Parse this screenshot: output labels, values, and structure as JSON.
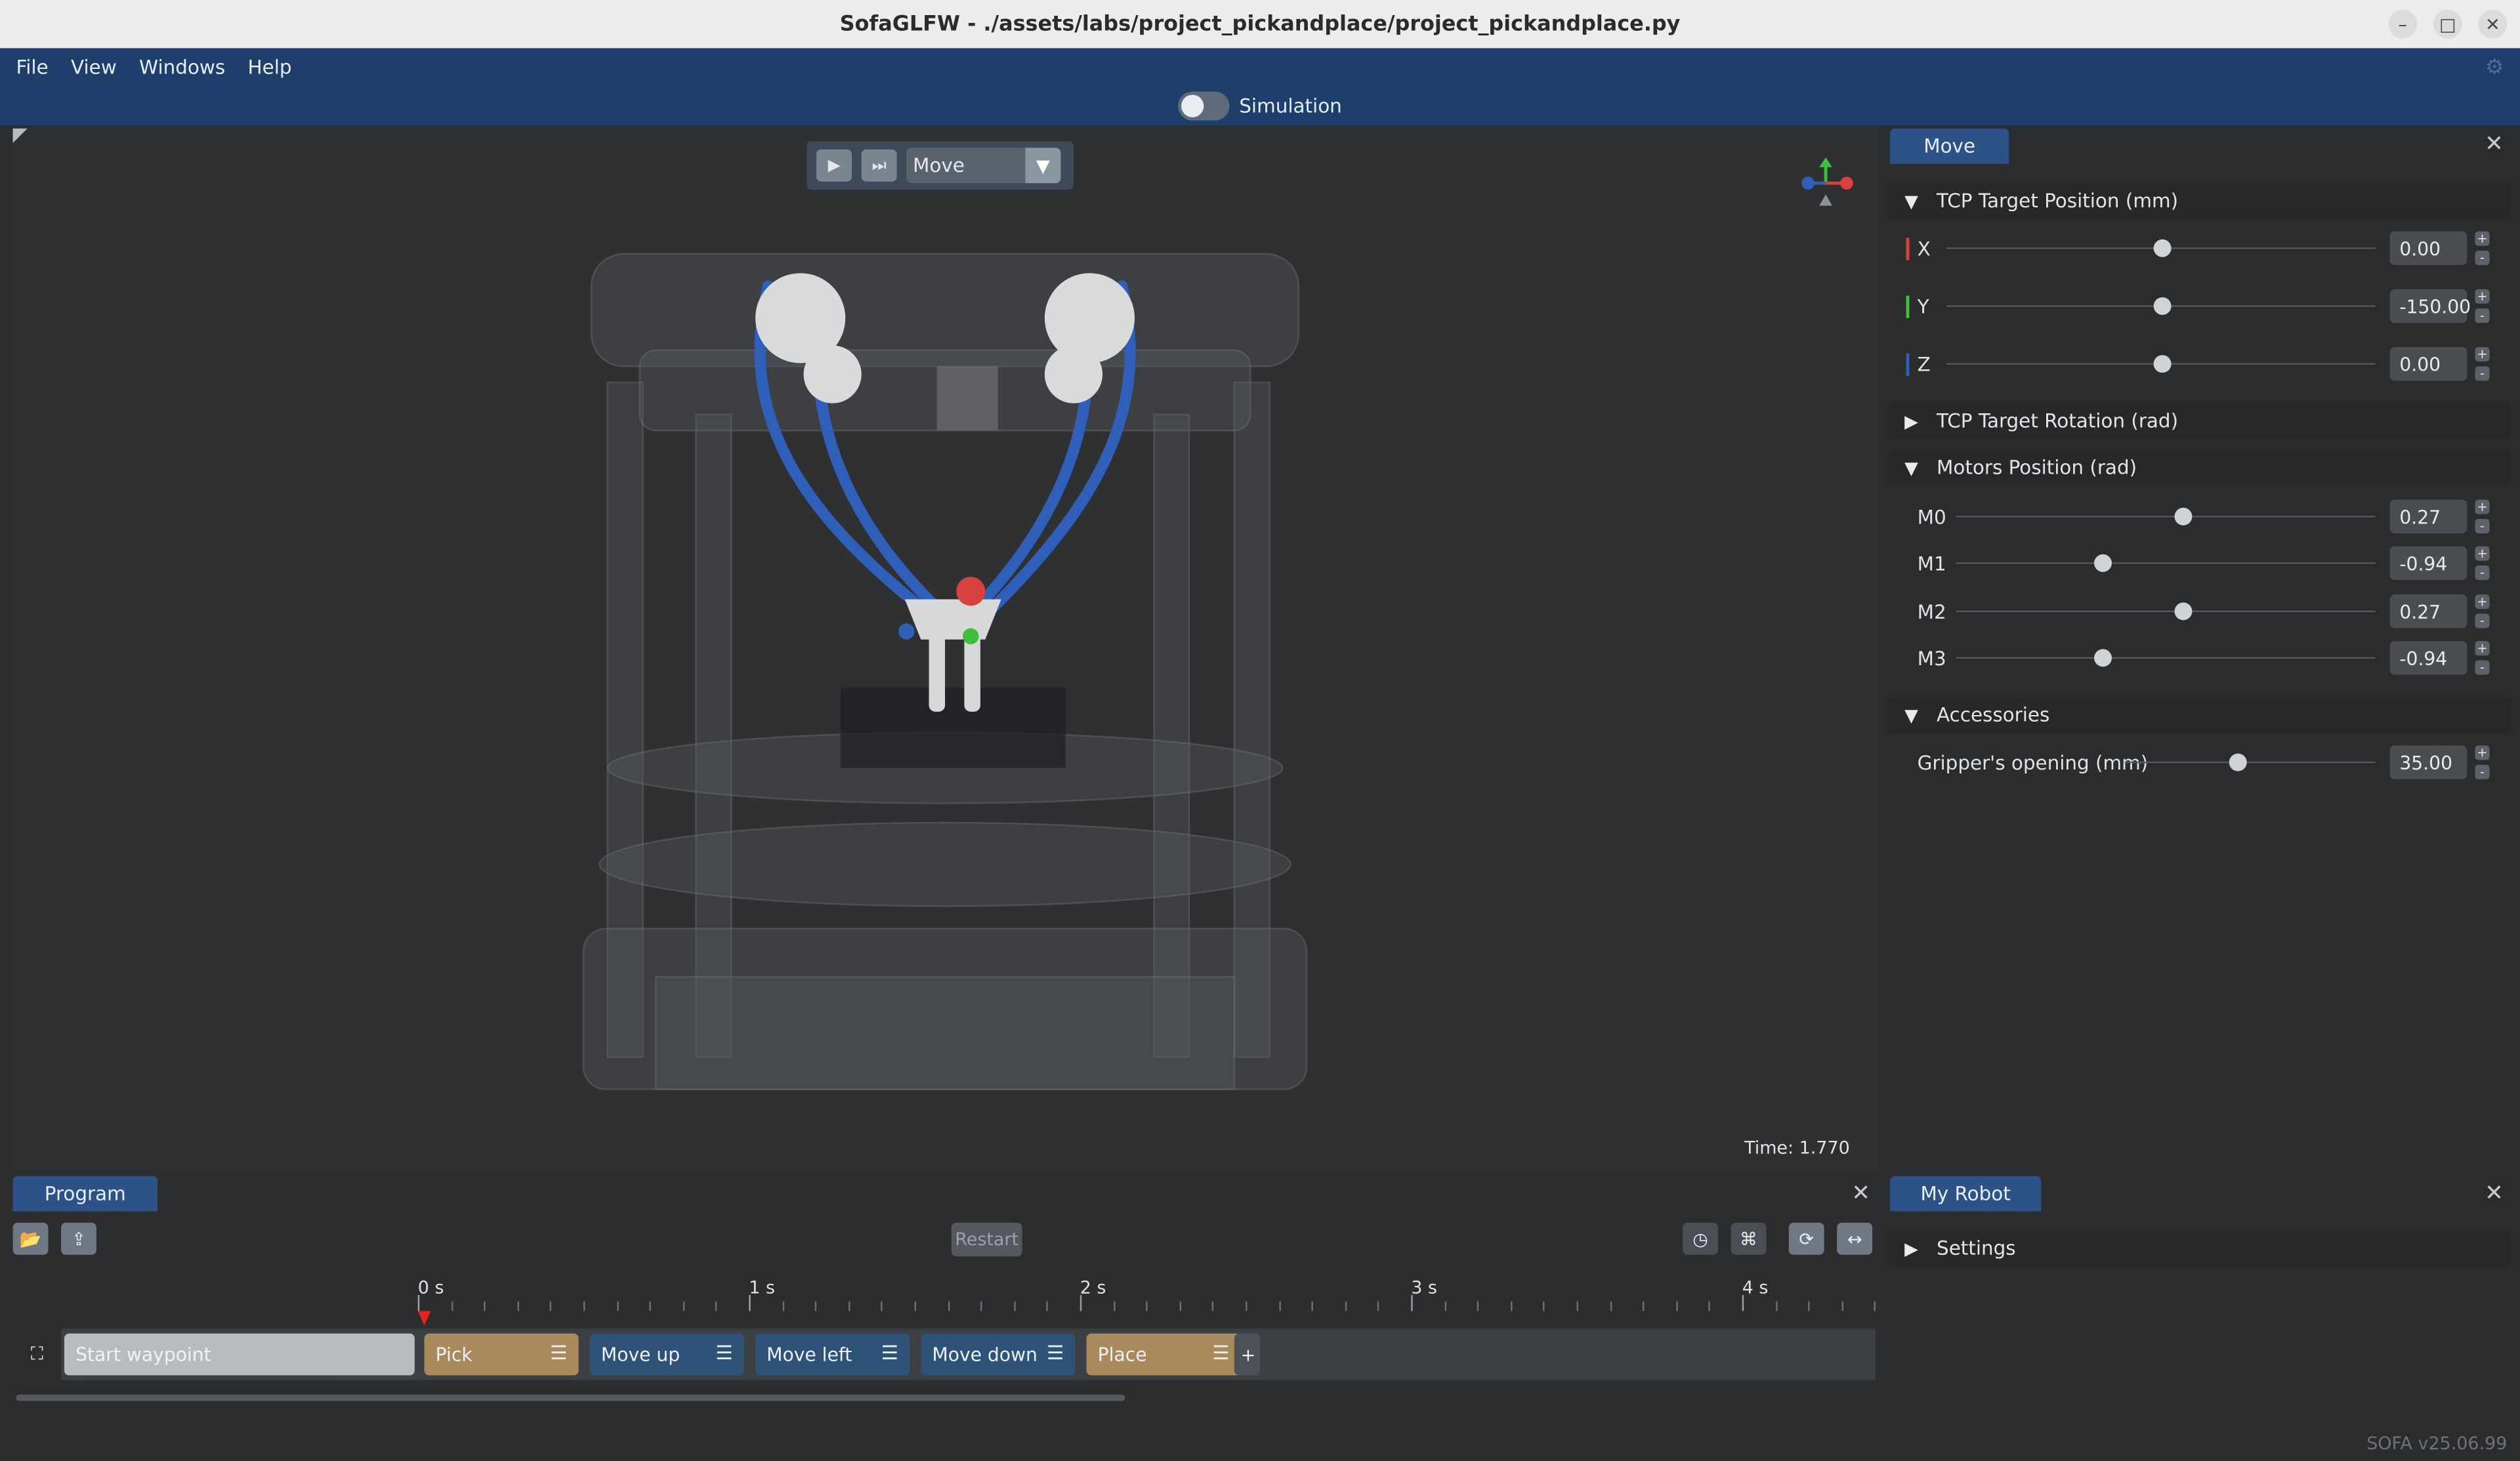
{
  "window": {
    "title": "SofaGLFW - ./assets/labs/project_pickandplace/project_pickandplace.py",
    "controls": [
      "–",
      "□",
      "✕"
    ]
  },
  "menu": [
    "File",
    "View",
    "Windows",
    "Help"
  ],
  "simulation": {
    "label": "Simulation",
    "enabled": false
  },
  "viewport": {
    "mode_select": "Move",
    "time_label": "Time: 1.770"
  },
  "move_panel": {
    "tab": "Move",
    "sections": {
      "tcp_position": {
        "title": "TCP Target Position (mm)",
        "rows": [
          {
            "label": "X",
            "value": "0.00",
            "slider": 0.5
          },
          {
            "label": "Y",
            "value": "-150.00",
            "slider": 0.5
          },
          {
            "label": "Z",
            "value": "0.00",
            "slider": 0.5
          }
        ]
      },
      "tcp_rotation": {
        "title": "TCP Target Rotation (rad)"
      },
      "motors": {
        "title": "Motors Position (rad)",
        "rows": [
          {
            "label": "M0",
            "value": "0.27",
            "slider": 0.54
          },
          {
            "label": "M1",
            "value": "-0.94",
            "slider": 0.35
          },
          {
            "label": "M2",
            "value": "0.27",
            "slider": 0.54
          },
          {
            "label": "M3",
            "value": "-0.94",
            "slider": 0.35
          }
        ]
      },
      "accessories": {
        "title": "Accessories",
        "rows": [
          {
            "label": "Gripper's opening (mm)",
            "value": "35.00",
            "slider": 0.45
          }
        ]
      }
    }
  },
  "program_panel": {
    "tab": "Program",
    "restart_label": "Restart",
    "ruler": [
      "0 s",
      "1 s",
      "2 s",
      "3 s",
      "4 s"
    ],
    "blocks": [
      {
        "label": "Start waypoint",
        "kind": "start"
      },
      {
        "label": "Pick",
        "kind": "gripper"
      },
      {
        "label": "Move up",
        "kind": "move"
      },
      {
        "label": "Move left",
        "kind": "move"
      },
      {
        "label": "Move down",
        "kind": "move"
      },
      {
        "label": "Place",
        "kind": "gripper"
      }
    ],
    "add_label": "+"
  },
  "robot_panel": {
    "tab": "My Robot",
    "settings": "Settings"
  },
  "status": {
    "version": "SOFA v25.06.99"
  },
  "colors": {
    "accent": "#2c5287",
    "menubar": "#1e3f6b",
    "move_block": "#2f5278",
    "gripper_block": "#a88a5c",
    "start_block": "#b9bcbf",
    "axis_x": "#d8413d",
    "axis_y": "#3fbf3c",
    "axis_z": "#2f5fb8"
  }
}
